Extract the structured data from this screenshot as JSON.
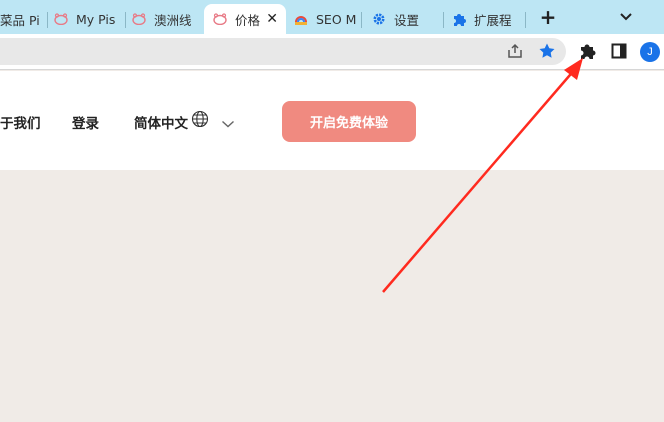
{
  "tabs": [
    {
      "label": "菜品 Pi",
      "icon": "pig-favicon-icon"
    },
    {
      "label": "My Pis",
      "icon": "pig-favicon-icon"
    },
    {
      "label": "澳洲线",
      "icon": "pig-favicon-icon"
    },
    {
      "label": "价格",
      "icon": "pig-favicon-icon",
      "active": true
    },
    {
      "label": "SEO M",
      "icon": "seo-favicon-icon"
    },
    {
      "label": "设置",
      "icon": "gear-icon"
    },
    {
      "label": "扩展程",
      "icon": "puzzle-icon"
    }
  ],
  "new_tab_symbol": "+",
  "close_symbol": "✕",
  "toolbar": {
    "avatar_initial": "J",
    "accent_color": "#1a73e8"
  },
  "nav": {
    "about": "于我们",
    "login": "登录",
    "language": "简体中文",
    "cta": "开启免费体验"
  },
  "colors": {
    "tabbar": "#bde6f4",
    "cta": "#f08a80",
    "content_bg": "#f0ebe7",
    "arrow": "#ff2a1f"
  }
}
